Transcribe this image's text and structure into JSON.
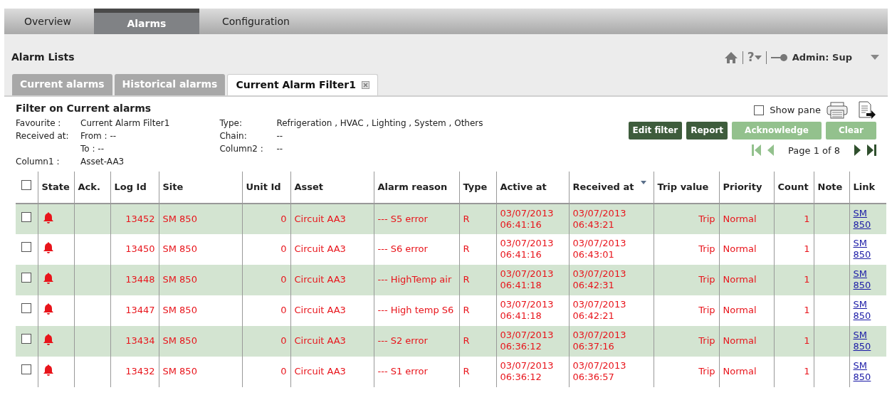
{
  "nav_tabs": [
    {
      "label": "Overview",
      "selected": false
    },
    {
      "label": "Alarms",
      "selected": true
    },
    {
      "label": "Configuration",
      "selected": false
    }
  ],
  "header": {
    "title": "Alarm Lists",
    "help": "?",
    "user": "Admin: Sup"
  },
  "sub_tabs": [
    {
      "label": "Current alarms",
      "selected": false,
      "closable": false
    },
    {
      "label": "Historical alarms",
      "selected": false,
      "closable": false
    },
    {
      "label": "Current Alarm Filter1",
      "selected": true,
      "closable": true
    }
  ],
  "filter": {
    "title": "Filter on Current alarms",
    "left_fields": [
      {
        "label": "Favourite :",
        "value": "Current Alarm Filter1"
      },
      {
        "label": "Received at:",
        "value": "From : --"
      },
      {
        "value": "To : --"
      },
      {
        "label": "Column1 :",
        "value": "Asset-AA3"
      }
    ],
    "right_fields": [
      {
        "label": "Type:",
        "value": "Refrigeration , HVAC , Lighting , System , Others"
      },
      {
        "label": "Chain:",
        "value": "--"
      },
      {
        "label": "Column2 :",
        "value": "--"
      }
    ]
  },
  "show_pane": {
    "label": "Show pane",
    "checked": false
  },
  "buttons": [
    {
      "label": "Edit filter",
      "disabled": false
    },
    {
      "label": "Report",
      "disabled": false
    },
    {
      "label": "Acknowledge",
      "disabled": true
    },
    {
      "label": "Clear",
      "disabled": true
    }
  ],
  "pagination": {
    "text": "Page 1 of 8",
    "at_first": true,
    "at_last": false
  },
  "table": {
    "select_all_checked": false,
    "columns": [
      {
        "label": "State",
        "sorted": false
      },
      {
        "label": "Ack.",
        "sorted": false
      },
      {
        "label": "Log Id",
        "sorted": false
      },
      {
        "label": "Site",
        "sorted": false
      },
      {
        "label": "Unit Id",
        "sorted": false
      },
      {
        "label": "Asset",
        "sorted": false
      },
      {
        "label": "Alarm reason",
        "sorted": false
      },
      {
        "label": "Type",
        "sorted": false
      },
      {
        "label": "Active at",
        "sorted": false
      },
      {
        "label": "Received at",
        "sorted": true
      },
      {
        "label": "Trip value",
        "sorted": false
      },
      {
        "label": "Priority",
        "sorted": false
      },
      {
        "label": "Count",
        "sorted": false
      },
      {
        "label": "Note",
        "sorted": false
      },
      {
        "label": "Link",
        "sorted": false
      }
    ],
    "rows": [
      {
        "checked": false,
        "log_id": "13452",
        "site": "SM 850",
        "unit_id": "0",
        "asset": "Circuit AA3",
        "reason": "--- S5 error",
        "type": "R",
        "active_at": "03/07/2013 06:41:16",
        "received_at": "03/07/2013 06:43:21",
        "trip_value": "Trip",
        "priority": "Normal",
        "count": "1",
        "link": "SM 850"
      },
      {
        "checked": false,
        "log_id": "13450",
        "site": "SM 850",
        "unit_id": "0",
        "asset": "Circuit AA3",
        "reason": "--- S6 error",
        "type": "R",
        "active_at": "03/07/2013 06:41:16",
        "received_at": "03/07/2013 06:43:01",
        "trip_value": "Trip",
        "priority": "Normal",
        "count": "1",
        "link": "SM 850"
      },
      {
        "checked": false,
        "log_id": "13448",
        "site": "SM 850",
        "unit_id": "0",
        "asset": "Circuit AA3",
        "reason": "--- HighTemp air",
        "type": "R",
        "active_at": "03/07/2013 06:41:18",
        "received_at": "03/07/2013 06:42:31",
        "trip_value": "Trip",
        "priority": "Normal",
        "count": "1",
        "link": "SM 850"
      },
      {
        "checked": false,
        "log_id": "13447",
        "site": "SM 850",
        "unit_id": "0",
        "asset": "Circuit AA3",
        "reason": "--- High temp S6",
        "type": "R",
        "active_at": "03/07/2013 06:41:18",
        "received_at": "03/07/2013 06:42:21",
        "trip_value": "Trip",
        "priority": "Normal",
        "count": "1",
        "link": "SM 850"
      },
      {
        "checked": false,
        "log_id": "13434",
        "site": "SM 850",
        "unit_id": "0",
        "asset": "Circuit AA3",
        "reason": "--- S2 error",
        "type": "R",
        "active_at": "03/07/2013 06:36:12",
        "received_at": "03/07/2013 06:37:16",
        "trip_value": "Trip",
        "priority": "Normal",
        "count": "1",
        "link": "SM 850"
      },
      {
        "checked": false,
        "log_id": "13432",
        "site": "SM 850",
        "unit_id": "0",
        "asset": "Circuit AA3",
        "reason": "--- S1 error",
        "type": "R",
        "active_at": "03/07/2013 06:36:12",
        "received_at": "03/07/2013 06:36:57",
        "trip_value": "Trip",
        "priority": "Normal",
        "count": "1",
        "link": "SM 850"
      }
    ]
  }
}
